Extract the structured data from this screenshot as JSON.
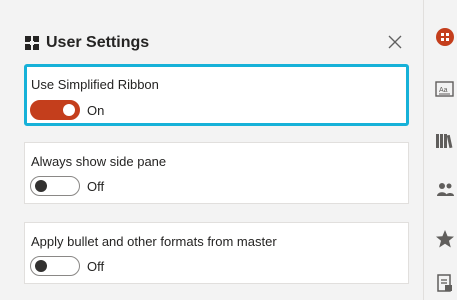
{
  "panel": {
    "title": "User Settings",
    "close_label": "Close"
  },
  "settings": [
    {
      "label": "Use Simplified Ribbon",
      "state": "On",
      "enabled": true
    },
    {
      "label": "Always show side pane",
      "state": "Off",
      "enabled": false
    },
    {
      "label": "Apply bullet and other formats from master",
      "state": "Off",
      "enabled": false
    }
  ],
  "rail": {
    "items": [
      {
        "icon": "user-settings-icon",
        "active": true
      },
      {
        "icon": "text-format-icon",
        "active": false
      },
      {
        "icon": "library-books-icon",
        "active": false
      },
      {
        "icon": "users-icon",
        "active": false
      },
      {
        "icon": "star-icon",
        "active": false
      },
      {
        "icon": "document-icon",
        "active": false
      }
    ]
  },
  "colors": {
    "accent": "#c43e1c",
    "selection_border": "#16b1d8",
    "background": "#f3f3f3",
    "card": "#ffffff"
  }
}
